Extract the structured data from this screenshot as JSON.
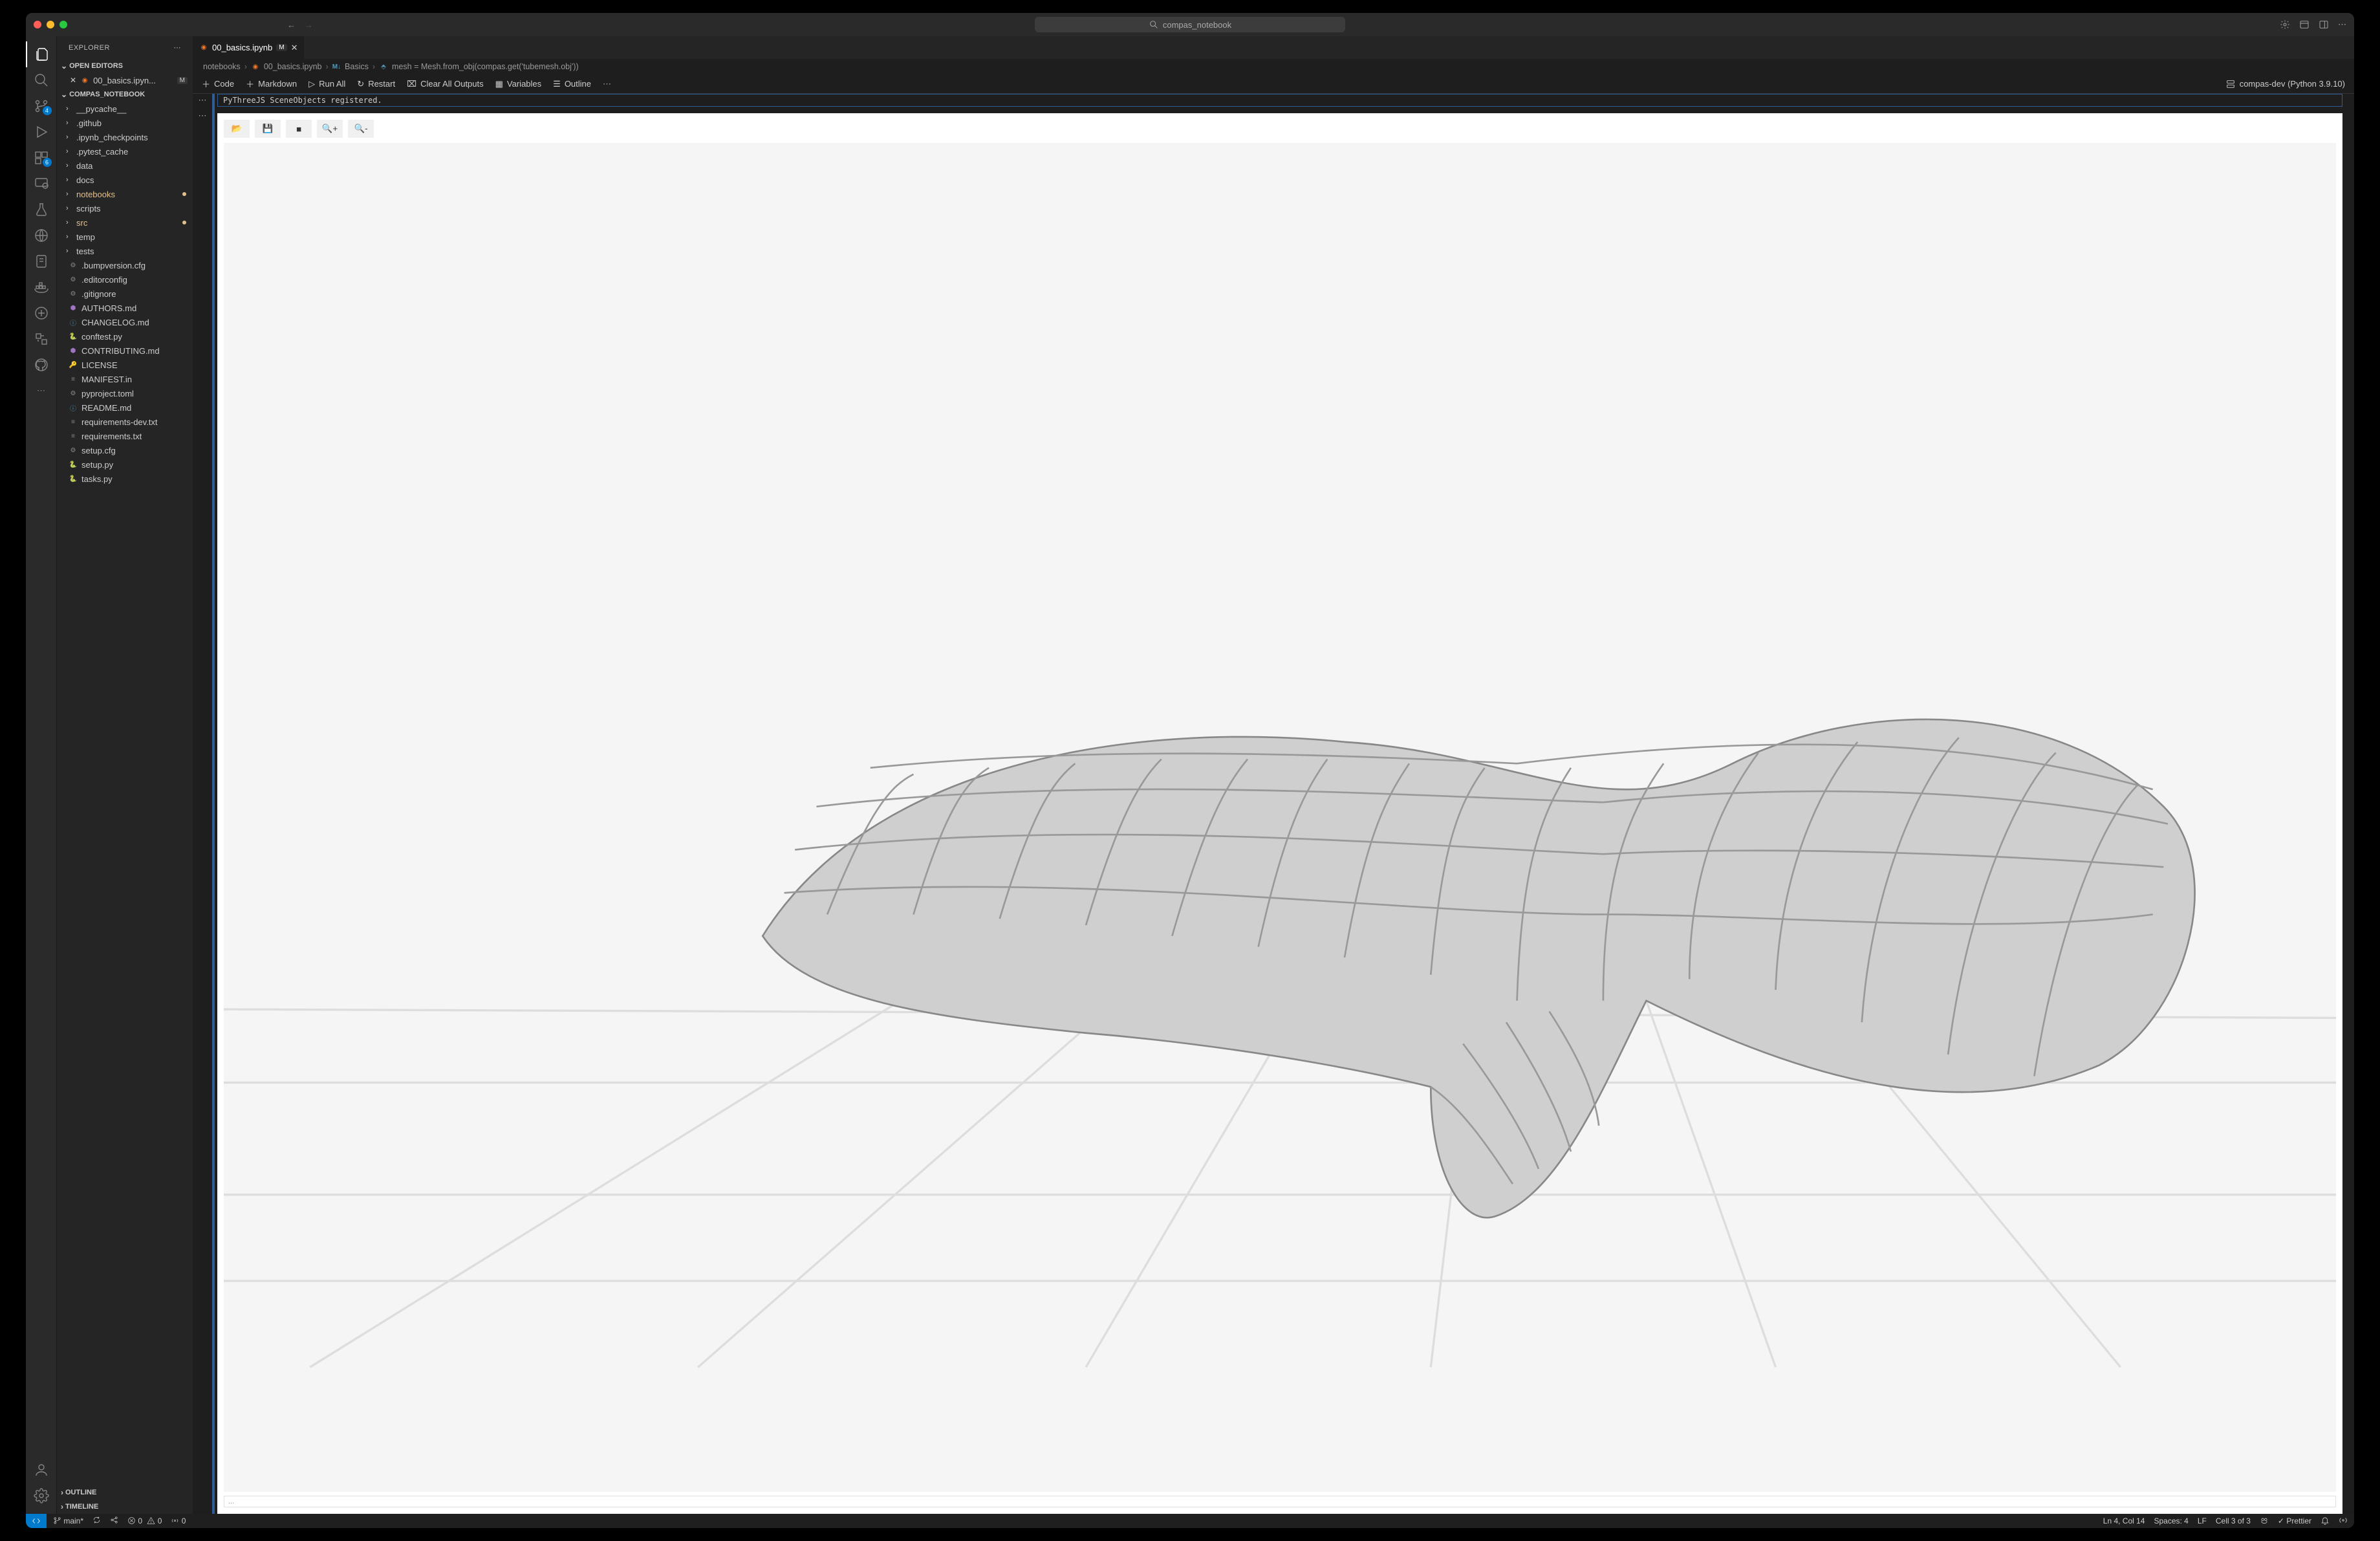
{
  "titlebar": {
    "search": "compas_notebook"
  },
  "sidebar": {
    "title": "EXPLORER",
    "openEditors": {
      "label": "OPEN EDITORS",
      "items": [
        {
          "name": "00_basics.ipyn...",
          "modified": "M"
        }
      ]
    },
    "project": {
      "name": "COMPAS_NOTEBOOK",
      "folders": [
        {
          "name": "__pycache__"
        },
        {
          "name": ".github"
        },
        {
          "name": ".ipynb_checkpoints"
        },
        {
          "name": ".pytest_cache"
        },
        {
          "name": "data"
        },
        {
          "name": "docs"
        },
        {
          "name": "notebooks",
          "highlight": true,
          "dot": true
        },
        {
          "name": "scripts"
        },
        {
          "name": "src",
          "highlight": true,
          "dot": true
        },
        {
          "name": "temp"
        },
        {
          "name": "tests"
        }
      ],
      "files": [
        {
          "name": ".bumpversion.cfg",
          "icon": "gear"
        },
        {
          "name": ".editorconfig",
          "icon": "gear"
        },
        {
          "name": ".gitignore",
          "icon": "gear"
        },
        {
          "name": "AUTHORS.md",
          "icon": "md-yaml"
        },
        {
          "name": "CHANGELOG.md",
          "icon": "info"
        },
        {
          "name": "conftest.py",
          "icon": "python"
        },
        {
          "name": "CONTRIBUTING.md",
          "icon": "md-yaml"
        },
        {
          "name": "LICENSE",
          "icon": "license"
        },
        {
          "name": "MANIFEST.in",
          "icon": "text"
        },
        {
          "name": "pyproject.toml",
          "icon": "gear"
        },
        {
          "name": "README.md",
          "icon": "info"
        },
        {
          "name": "requirements-dev.txt",
          "icon": "text"
        },
        {
          "name": "requirements.txt",
          "icon": "text"
        },
        {
          "name": "setup.cfg",
          "icon": "gear"
        },
        {
          "name": "setup.py",
          "icon": "python"
        },
        {
          "name": "tasks.py",
          "icon": "python"
        }
      ]
    },
    "outline": "OUTLINE",
    "timeline": "TIMELINE"
  },
  "activity": {
    "scm_badge": "4",
    "ext_badge": "6"
  },
  "tab": {
    "name": "00_basics.ipynb",
    "modified": "M"
  },
  "breadcrumbs": {
    "parts": [
      "notebooks",
      "00_basics.ipynb",
      "Basics",
      "mesh = Mesh.from_obj(compas.get('tubemesh.obj'))"
    ]
  },
  "nbToolbar": {
    "code": "Code",
    "markdown": "Markdown",
    "runAll": "Run All",
    "restart": "Restart",
    "clearOutputs": "Clear All Outputs",
    "variables": "Variables",
    "outline": "Outline",
    "kernel": "compas-dev (Python 3.9.10)"
  },
  "cell": {
    "outputText": "PyThreeJS SceneObjects registered.",
    "footer": "..."
  },
  "statusbar": {
    "branch": "main*",
    "errors": "0",
    "warnings": "0",
    "ports": "0",
    "lnCol": "Ln 4, Col 14",
    "spaces": "Spaces: 4",
    "eol": "LF",
    "cellIdx": "Cell 3 of 3",
    "prettier": "Prettier"
  }
}
